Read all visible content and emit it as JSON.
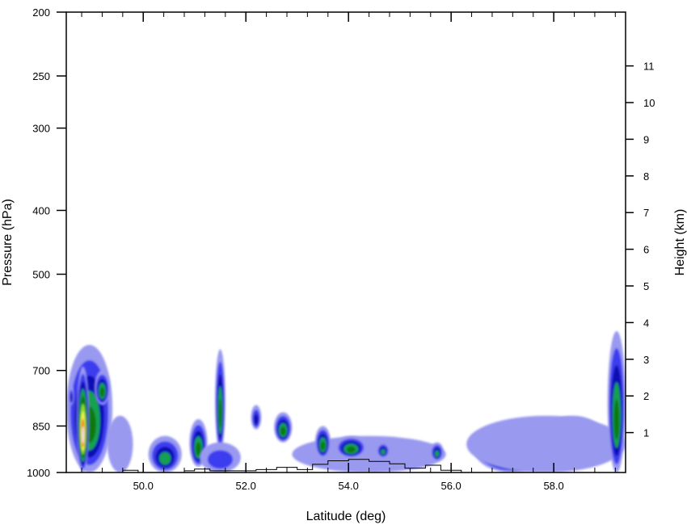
{
  "chart_data": {
    "type": "heatmap",
    "title": "",
    "xlabel": "Latitude (deg)",
    "ylabel_left": "Pressure (hPa)",
    "ylabel_right": "Height (km)",
    "xlim": [
      48.5,
      59.4
    ],
    "x_ticks": [
      {
        "value": 50,
        "label": "50.0"
      },
      {
        "value": 52,
        "label": "52.0"
      },
      {
        "value": 54,
        "label": "54.0"
      },
      {
        "value": 56,
        "label": "56.0"
      },
      {
        "value": 58,
        "label": "58.0"
      }
    ],
    "ylim_pressure": [
      1000,
      200
    ],
    "y_scale": "log",
    "y_ticks_pressure": [
      1000,
      850,
      700,
      500,
      400,
      300,
      250,
      200
    ],
    "y_ticks_height_km": [
      1,
      2,
      3,
      4,
      5,
      6,
      7,
      8,
      9,
      10,
      11
    ],
    "colors": {
      "level1": "#9999f0",
      "level2": "#3c3cf0",
      "level3": "#0f0fb4",
      "level4": "#19a050",
      "level5": "#0f780f",
      "level6": "#8cdc3c",
      "level7": "#f0f050",
      "level8": "#f07814",
      "level9": "#f0f0f0"
    },
    "cells": [
      {
        "lat_min": 48.5,
        "lat_max": 49.4,
        "p_top": 640,
        "p_bottom": 1000,
        "levels": 5
      },
      {
        "lat_min": 48.7,
        "lat_max": 48.95,
        "p_top": 690,
        "p_bottom": 1000,
        "levels": 9
      },
      {
        "lat_min": 49.05,
        "lat_max": 49.35,
        "p_top": 700,
        "p_bottom": 790,
        "levels": 5
      },
      {
        "lat_min": 48.55,
        "lat_max": 48.65,
        "p_top": 740,
        "p_bottom": 790,
        "levels": 3
      },
      {
        "lat_min": 49.3,
        "lat_max": 49.8,
        "p_top": 820,
        "p_bottom": 1000,
        "levels": 1
      },
      {
        "lat_min": 50.1,
        "lat_max": 50.75,
        "p_top": 880,
        "p_bottom": 1000,
        "levels": 4
      },
      {
        "lat_min": 50.9,
        "lat_max": 51.25,
        "p_top": 830,
        "p_bottom": 980,
        "levels": 5
      },
      {
        "lat_min": 51.4,
        "lat_max": 51.6,
        "p_top": 650,
        "p_bottom": 930,
        "levels": 5
      },
      {
        "lat_min": 51.1,
        "lat_max": 51.9,
        "p_top": 900,
        "p_bottom": 1000,
        "levels": 2
      },
      {
        "lat_min": 52.1,
        "lat_max": 52.3,
        "p_top": 790,
        "p_bottom": 860,
        "levels": 3
      },
      {
        "lat_min": 52.55,
        "lat_max": 52.9,
        "p_top": 810,
        "p_bottom": 900,
        "levels": 5
      },
      {
        "lat_min": 52.9,
        "lat_max": 55.9,
        "p_top": 880,
        "p_bottom": 1000,
        "levels": 1
      },
      {
        "lat_min": 53.35,
        "lat_max": 53.65,
        "p_top": 850,
        "p_bottom": 950,
        "levels": 5
      },
      {
        "lat_min": 53.75,
        "lat_max": 54.35,
        "p_top": 880,
        "p_bottom": 950,
        "levels": 5
      },
      {
        "lat_min": 54.55,
        "lat_max": 54.8,
        "p_top": 900,
        "p_bottom": 950,
        "levels": 4
      },
      {
        "lat_min": 55.6,
        "lat_max": 55.85,
        "p_top": 900,
        "p_bottom": 960,
        "levels": 4
      },
      {
        "lat_min": 56.45,
        "lat_max": 57.9,
        "p_top": 850,
        "p_bottom": 1000,
        "levels": 7
      },
      {
        "lat_min": 57.75,
        "lat_max": 59.0,
        "p_top": 820,
        "p_bottom": 960,
        "levels": 6
      },
      {
        "lat_min": 56.3,
        "lat_max": 59.4,
        "p_top": 820,
        "p_bottom": 1000,
        "levels": 1
      },
      {
        "lat_min": 59.05,
        "lat_max": 59.4,
        "p_top": 610,
        "p_bottom": 1000,
        "levels": 5
      }
    ]
  }
}
